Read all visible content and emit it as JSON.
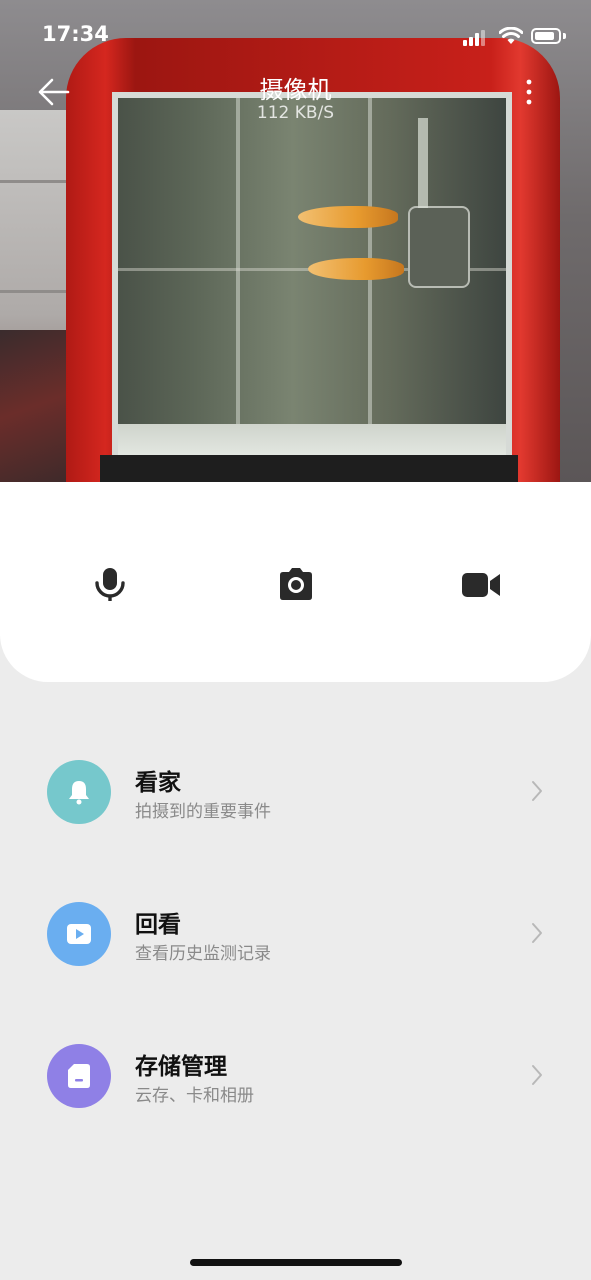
{
  "status_bar": {
    "time": "17:34"
  },
  "header": {
    "title": "摄像机",
    "speed": "112 KB/S"
  },
  "controls": [
    {
      "name": "microphone",
      "icon": "microphone-icon"
    },
    {
      "name": "snapshot",
      "icon": "camera-icon"
    },
    {
      "name": "record",
      "icon": "video-camera-icon"
    }
  ],
  "menu": {
    "items": [
      {
        "title": "看家",
        "subtitle": "拍摄到的重要事件",
        "icon": "bell-icon",
        "color": "#76c8cc"
      },
      {
        "title": "回看",
        "subtitle": "查看历史监测记录",
        "icon": "play-icon",
        "color": "#6aaef0"
      },
      {
        "title": "存储管理",
        "subtitle": "云存、卡和相册",
        "icon": "sd-card-icon",
        "color": "#8f80e6"
      }
    ]
  },
  "colors": {
    "page_bg": "#ececec",
    "panel_bg": "#ffffff"
  }
}
